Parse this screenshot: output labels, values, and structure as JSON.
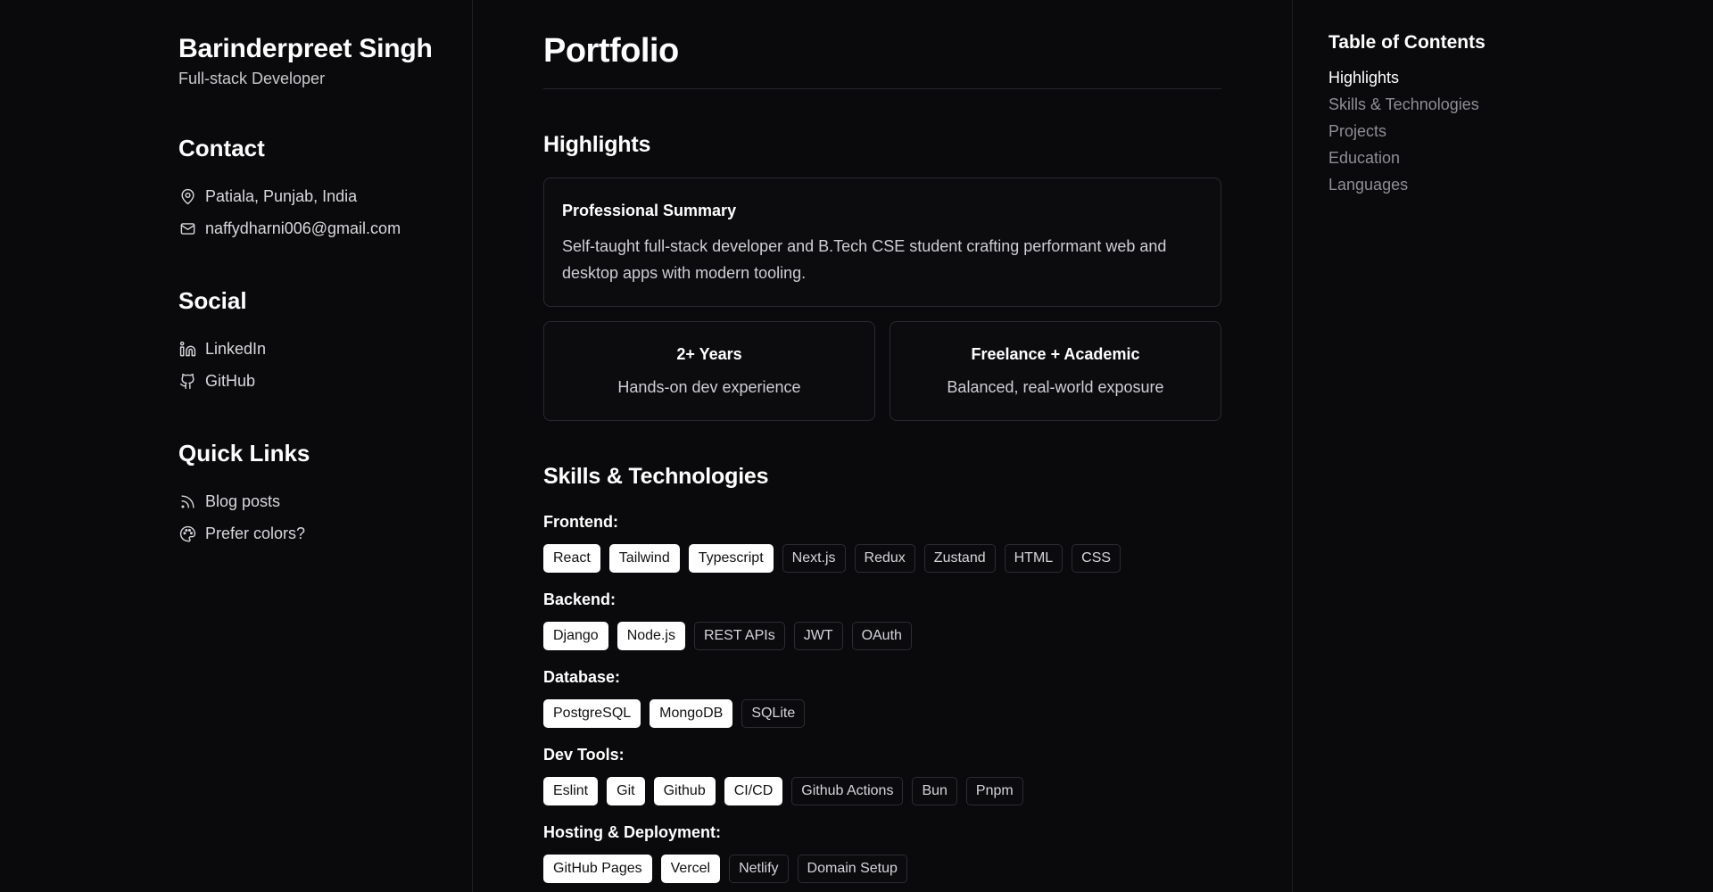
{
  "profile": {
    "name": "Barinderpreet Singh",
    "role": "Full-stack Developer"
  },
  "contact": {
    "heading": "Contact",
    "location": "Patiala, Punjab, India",
    "email": "naffydharni006@gmail.com"
  },
  "social": {
    "heading": "Social",
    "linkedin": "LinkedIn",
    "github": "GitHub"
  },
  "quick_links": {
    "heading": "Quick Links",
    "blog": "Blog posts",
    "colors": "Prefer colors?"
  },
  "main": {
    "title": "Portfolio",
    "highlights": {
      "heading": "Highlights",
      "summary_title": "Professional Summary",
      "summary_text": "Self-taught full-stack developer and B.Tech CSE student crafting performant web and desktop apps with modern tooling.",
      "stats": [
        {
          "title": "2+ Years",
          "desc": "Hands-on dev experience"
        },
        {
          "title": "Freelance + Academic",
          "desc": "Balanced, real-world exposure"
        }
      ]
    },
    "skills": {
      "heading": "Skills & Technologies",
      "categories": [
        {
          "label": "Frontend:",
          "tags": [
            "React",
            "Tailwind",
            "Typescript",
            "Next.js",
            "Redux",
            "Zustand",
            "HTML",
            "CSS"
          ]
        },
        {
          "label": "Backend:",
          "tags": [
            "Django",
            "Node.js",
            "REST APIs",
            "JWT",
            "OAuth"
          ]
        },
        {
          "label": "Database:",
          "tags": [
            "PostgreSQL",
            "MongoDB",
            "SQLite"
          ]
        },
        {
          "label": "Dev Tools:",
          "tags": [
            "Eslint",
            "Git",
            "Github",
            "CI/CD",
            "Github Actions",
            "Bun",
            "Pnpm"
          ]
        },
        {
          "label": "Hosting & Deployment:",
          "tags": [
            "GitHub Pages",
            "Vercel",
            "Netlify",
            "Domain Setup"
          ]
        }
      ]
    }
  },
  "toc": {
    "heading": "Table of Contents",
    "items": [
      "Highlights",
      "Skills & Technologies",
      "Projects",
      "Education",
      "Languages"
    ]
  },
  "colors": {
    "background": "#0a0a0c",
    "highlight_tag": "#ffffff",
    "muted": "#8e8e94"
  },
  "icons": {
    "location": "map-pin-icon",
    "email": "mail-icon",
    "linkedin": "linkedin-icon",
    "github": "github-icon",
    "blog": "rss-icon",
    "colors": "palette-icon"
  }
}
